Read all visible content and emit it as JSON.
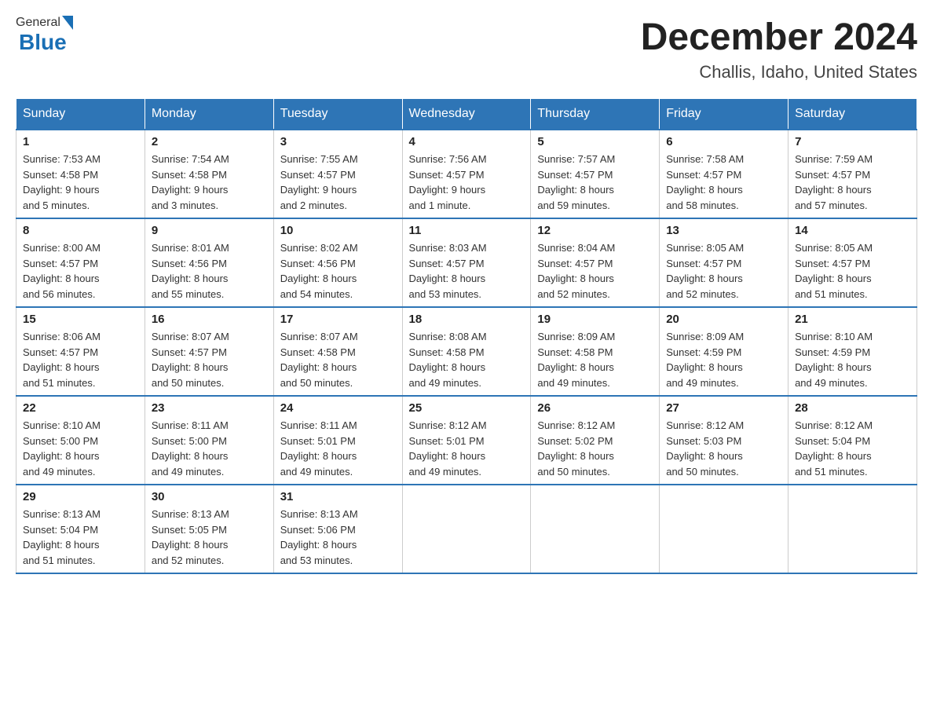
{
  "header": {
    "logo_general": "General",
    "logo_blue": "Blue",
    "month_title": "December 2024",
    "location": "Challis, Idaho, United States"
  },
  "days_of_week": [
    "Sunday",
    "Monday",
    "Tuesday",
    "Wednesday",
    "Thursday",
    "Friday",
    "Saturday"
  ],
  "weeks": [
    [
      {
        "day": "1",
        "sunrise": "Sunrise: 7:53 AM",
        "sunset": "Sunset: 4:58 PM",
        "daylight": "Daylight: 9 hours",
        "daylight2": "and 5 minutes."
      },
      {
        "day": "2",
        "sunrise": "Sunrise: 7:54 AM",
        "sunset": "Sunset: 4:58 PM",
        "daylight": "Daylight: 9 hours",
        "daylight2": "and 3 minutes."
      },
      {
        "day": "3",
        "sunrise": "Sunrise: 7:55 AM",
        "sunset": "Sunset: 4:57 PM",
        "daylight": "Daylight: 9 hours",
        "daylight2": "and 2 minutes."
      },
      {
        "day": "4",
        "sunrise": "Sunrise: 7:56 AM",
        "sunset": "Sunset: 4:57 PM",
        "daylight": "Daylight: 9 hours",
        "daylight2": "and 1 minute."
      },
      {
        "day": "5",
        "sunrise": "Sunrise: 7:57 AM",
        "sunset": "Sunset: 4:57 PM",
        "daylight": "Daylight: 8 hours",
        "daylight2": "and 59 minutes."
      },
      {
        "day": "6",
        "sunrise": "Sunrise: 7:58 AM",
        "sunset": "Sunset: 4:57 PM",
        "daylight": "Daylight: 8 hours",
        "daylight2": "and 58 minutes."
      },
      {
        "day": "7",
        "sunrise": "Sunrise: 7:59 AM",
        "sunset": "Sunset: 4:57 PM",
        "daylight": "Daylight: 8 hours",
        "daylight2": "and 57 minutes."
      }
    ],
    [
      {
        "day": "8",
        "sunrise": "Sunrise: 8:00 AM",
        "sunset": "Sunset: 4:57 PM",
        "daylight": "Daylight: 8 hours",
        "daylight2": "and 56 minutes."
      },
      {
        "day": "9",
        "sunrise": "Sunrise: 8:01 AM",
        "sunset": "Sunset: 4:56 PM",
        "daylight": "Daylight: 8 hours",
        "daylight2": "and 55 minutes."
      },
      {
        "day": "10",
        "sunrise": "Sunrise: 8:02 AM",
        "sunset": "Sunset: 4:56 PM",
        "daylight": "Daylight: 8 hours",
        "daylight2": "and 54 minutes."
      },
      {
        "day": "11",
        "sunrise": "Sunrise: 8:03 AM",
        "sunset": "Sunset: 4:57 PM",
        "daylight": "Daylight: 8 hours",
        "daylight2": "and 53 minutes."
      },
      {
        "day": "12",
        "sunrise": "Sunrise: 8:04 AM",
        "sunset": "Sunset: 4:57 PM",
        "daylight": "Daylight: 8 hours",
        "daylight2": "and 52 minutes."
      },
      {
        "day": "13",
        "sunrise": "Sunrise: 8:05 AM",
        "sunset": "Sunset: 4:57 PM",
        "daylight": "Daylight: 8 hours",
        "daylight2": "and 52 minutes."
      },
      {
        "day": "14",
        "sunrise": "Sunrise: 8:05 AM",
        "sunset": "Sunset: 4:57 PM",
        "daylight": "Daylight: 8 hours",
        "daylight2": "and 51 minutes."
      }
    ],
    [
      {
        "day": "15",
        "sunrise": "Sunrise: 8:06 AM",
        "sunset": "Sunset: 4:57 PM",
        "daylight": "Daylight: 8 hours",
        "daylight2": "and 51 minutes."
      },
      {
        "day": "16",
        "sunrise": "Sunrise: 8:07 AM",
        "sunset": "Sunset: 4:57 PM",
        "daylight": "Daylight: 8 hours",
        "daylight2": "and 50 minutes."
      },
      {
        "day": "17",
        "sunrise": "Sunrise: 8:07 AM",
        "sunset": "Sunset: 4:58 PM",
        "daylight": "Daylight: 8 hours",
        "daylight2": "and 50 minutes."
      },
      {
        "day": "18",
        "sunrise": "Sunrise: 8:08 AM",
        "sunset": "Sunset: 4:58 PM",
        "daylight": "Daylight: 8 hours",
        "daylight2": "and 49 minutes."
      },
      {
        "day": "19",
        "sunrise": "Sunrise: 8:09 AM",
        "sunset": "Sunset: 4:58 PM",
        "daylight": "Daylight: 8 hours",
        "daylight2": "and 49 minutes."
      },
      {
        "day": "20",
        "sunrise": "Sunrise: 8:09 AM",
        "sunset": "Sunset: 4:59 PM",
        "daylight": "Daylight: 8 hours",
        "daylight2": "and 49 minutes."
      },
      {
        "day": "21",
        "sunrise": "Sunrise: 8:10 AM",
        "sunset": "Sunset: 4:59 PM",
        "daylight": "Daylight: 8 hours",
        "daylight2": "and 49 minutes."
      }
    ],
    [
      {
        "day": "22",
        "sunrise": "Sunrise: 8:10 AM",
        "sunset": "Sunset: 5:00 PM",
        "daylight": "Daylight: 8 hours",
        "daylight2": "and 49 minutes."
      },
      {
        "day": "23",
        "sunrise": "Sunrise: 8:11 AM",
        "sunset": "Sunset: 5:00 PM",
        "daylight": "Daylight: 8 hours",
        "daylight2": "and 49 minutes."
      },
      {
        "day": "24",
        "sunrise": "Sunrise: 8:11 AM",
        "sunset": "Sunset: 5:01 PM",
        "daylight": "Daylight: 8 hours",
        "daylight2": "and 49 minutes."
      },
      {
        "day": "25",
        "sunrise": "Sunrise: 8:12 AM",
        "sunset": "Sunset: 5:01 PM",
        "daylight": "Daylight: 8 hours",
        "daylight2": "and 49 minutes."
      },
      {
        "day": "26",
        "sunrise": "Sunrise: 8:12 AM",
        "sunset": "Sunset: 5:02 PM",
        "daylight": "Daylight: 8 hours",
        "daylight2": "and 50 minutes."
      },
      {
        "day": "27",
        "sunrise": "Sunrise: 8:12 AM",
        "sunset": "Sunset: 5:03 PM",
        "daylight": "Daylight: 8 hours",
        "daylight2": "and 50 minutes."
      },
      {
        "day": "28",
        "sunrise": "Sunrise: 8:12 AM",
        "sunset": "Sunset: 5:04 PM",
        "daylight": "Daylight: 8 hours",
        "daylight2": "and 51 minutes."
      }
    ],
    [
      {
        "day": "29",
        "sunrise": "Sunrise: 8:13 AM",
        "sunset": "Sunset: 5:04 PM",
        "daylight": "Daylight: 8 hours",
        "daylight2": "and 51 minutes."
      },
      {
        "day": "30",
        "sunrise": "Sunrise: 8:13 AM",
        "sunset": "Sunset: 5:05 PM",
        "daylight": "Daylight: 8 hours",
        "daylight2": "and 52 minutes."
      },
      {
        "day": "31",
        "sunrise": "Sunrise: 8:13 AM",
        "sunset": "Sunset: 5:06 PM",
        "daylight": "Daylight: 8 hours",
        "daylight2": "and 53 minutes."
      },
      null,
      null,
      null,
      null
    ]
  ]
}
